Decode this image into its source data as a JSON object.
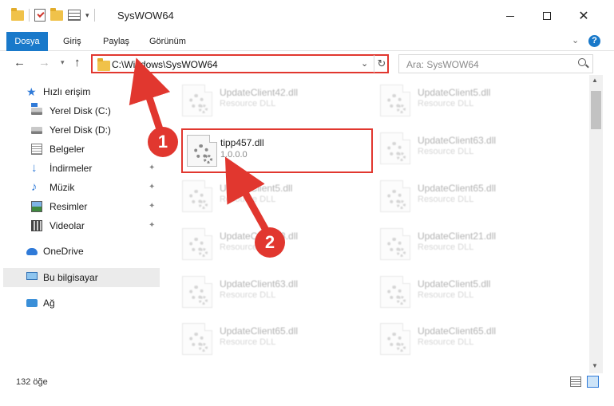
{
  "window": {
    "title": "SysWOW64",
    "min_glyph": "—",
    "close_glyph": "✕"
  },
  "ribbon": {
    "tabs": [
      "Dosya",
      "Giriş",
      "Paylaş",
      "Görünüm"
    ],
    "expand_glyph": "⌄",
    "help_glyph": "?"
  },
  "nav": {
    "back_glyph": "←",
    "forward_glyph": "→",
    "recent_glyph": "▾",
    "up_glyph": "↑",
    "address": "C:\\Windows\\SysWOW64",
    "address_dropdown_glyph": "⌄",
    "refresh_glyph": "↻",
    "search_placeholder": "Ara: SysWOW64"
  },
  "sidebar": {
    "items": [
      {
        "label": "Hızlı erişim",
        "icon": "star-icon"
      },
      {
        "label": "Yerel Disk (C:)",
        "icon": "drive-icon",
        "pinned": true
      },
      {
        "label": "Yerel Disk (D:)",
        "icon": "drive-icon",
        "pinned": true
      },
      {
        "label": "Belgeler",
        "icon": "documents-icon",
        "pinned": true
      },
      {
        "label": "İndirmeler",
        "icon": "downloads-icon",
        "pinned": true
      },
      {
        "label": "Müzik",
        "icon": "music-icon",
        "pinned": true
      },
      {
        "label": "Resimler",
        "icon": "pictures-icon",
        "pinned": true
      },
      {
        "label": "Videolar",
        "icon": "videos-icon",
        "pinned": true
      },
      {
        "label": "OneDrive",
        "icon": "onedrive-icon"
      },
      {
        "label": "Bu bilgisayar",
        "icon": "this-pc-icon",
        "selected": true
      },
      {
        "label": "Ağ",
        "icon": "network-icon"
      }
    ],
    "pin_glyph": "📌"
  },
  "files": {
    "highlighted": {
      "name": "tipp457.dll",
      "description": "1.0.0.0"
    },
    "left_column": [
      {
        "name": "UpdateClient42.dll",
        "description": "Resource DLL"
      },
      {
        "name": "UpdateClient5.dll",
        "description": "Resource DLL"
      },
      {
        "name": "UpdateClient63.dll",
        "description": "Resource DLL"
      },
      {
        "name": "UpdateClient63.dll",
        "description": "Resource DLL"
      },
      {
        "name": "UpdateClient65.dll",
        "description": "Resource DLL"
      }
    ],
    "right_column": [
      {
        "name": "UpdateClient5.dll",
        "description": "Resource DLL"
      },
      {
        "name": "UpdateClient63.dll",
        "description": "Resource DLL"
      },
      {
        "name": "UpdateClient65.dll",
        "description": "Resource DLL"
      },
      {
        "name": "UpdateClient21.dll",
        "description": "Resource DLL"
      },
      {
        "name": "UpdateClient5.dll",
        "description": "Resource DLL"
      },
      {
        "name": "UpdateClient65.dll",
        "description": "Resource DLL"
      }
    ]
  },
  "scrollbar": {
    "up_glyph": "▲",
    "down_glyph": "▼"
  },
  "status": {
    "item_count": "132 öğe"
  },
  "annotations": {
    "step1": "1",
    "step2": "2",
    "color": "#e1372f"
  }
}
